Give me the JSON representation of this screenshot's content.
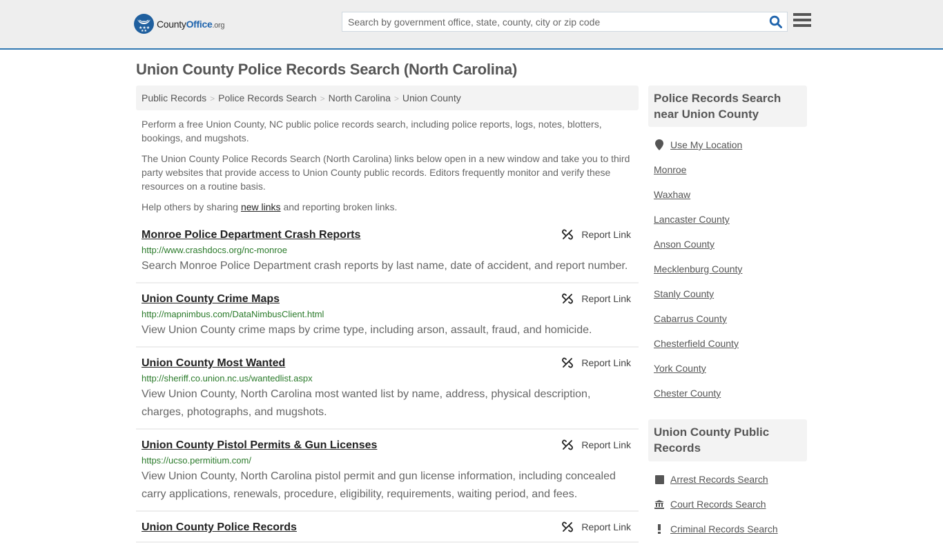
{
  "header": {
    "logo": {
      "name": "County",
      "office": "Office",
      "tld": ".org"
    },
    "search_placeholder": "Search by government office, state, county, city or zip code",
    "search_value": ""
  },
  "page": {
    "title": "Union County Police Records Search (North Carolina)",
    "breadcrumb": [
      "Public Records",
      "Police Records Search",
      "North Carolina",
      "Union County"
    ],
    "intro": {
      "p1": "Perform a free Union County, NC public police records search, including police reports, logs, notes, blotters, bookings, and mugshots.",
      "p2": "The Union County Police Records Search (North Carolina) links below open in a new window and take you to third party websites that provide access to Union County public records. Editors frequently monitor and verify these resources on a routine basis.",
      "p3_before": "Help others by sharing ",
      "p3_link": "new links",
      "p3_after": " and reporting broken links."
    }
  },
  "results": [
    {
      "title": "Monroe Police Department Crash Reports",
      "url": "http://www.crashdocs.org/nc-monroe",
      "description": "Search Monroe Police Department crash reports by last name, date of accident, and report number.",
      "report_label": "Report Link"
    },
    {
      "title": "Union County Crime Maps",
      "url": "http://mapnimbus.com/DataNimbusClient.html",
      "description": "View Union County crime maps by crime type, including arson, assault, fraud, and homicide.",
      "report_label": "Report Link"
    },
    {
      "title": "Union County Most Wanted",
      "url": "http://sheriff.co.union.nc.us/wantedlist.aspx",
      "description": "View Union County, North Carolina most wanted list by name, address, physical description, charges, photographs, and mugshots.",
      "report_label": "Report Link"
    },
    {
      "title": "Union County Pistol Permits & Gun Licenses",
      "url": "https://ucso.permitium.com/",
      "description": "View Union County, North Carolina pistol permit and gun license information, including concealed carry applications, renewals, procedure, eligibility, requirements, waiting period, and fees.",
      "report_label": "Report Link"
    },
    {
      "title": "Union County Police Records",
      "url": "",
      "description": "",
      "report_label": "Report Link"
    }
  ],
  "sidebar": {
    "nearby": {
      "heading": "Police Records Search near Union County",
      "use_location": "Use My Location",
      "items": [
        "Monroe",
        "Waxhaw",
        "Lancaster County",
        "Anson County",
        "Mecklenburg County",
        "Stanly County",
        "Cabarrus County",
        "Chesterfield County",
        "York County",
        "Chester County"
      ]
    },
    "public_records": {
      "heading": "Union County Public Records",
      "items": [
        {
          "label": "Arrest Records Search",
          "icon": "square-icon"
        },
        {
          "label": "Court Records Search",
          "icon": "courthouse-icon"
        },
        {
          "label": "Criminal Records Search",
          "icon": "exclamation-icon"
        }
      ]
    }
  },
  "colors": {
    "header_bg": "#eeeeee",
    "header_border": "#3077b1",
    "brand_blue": "#1f64ad",
    "url_green": "#2a7a2a",
    "search_icon": "#1f64ad"
  }
}
